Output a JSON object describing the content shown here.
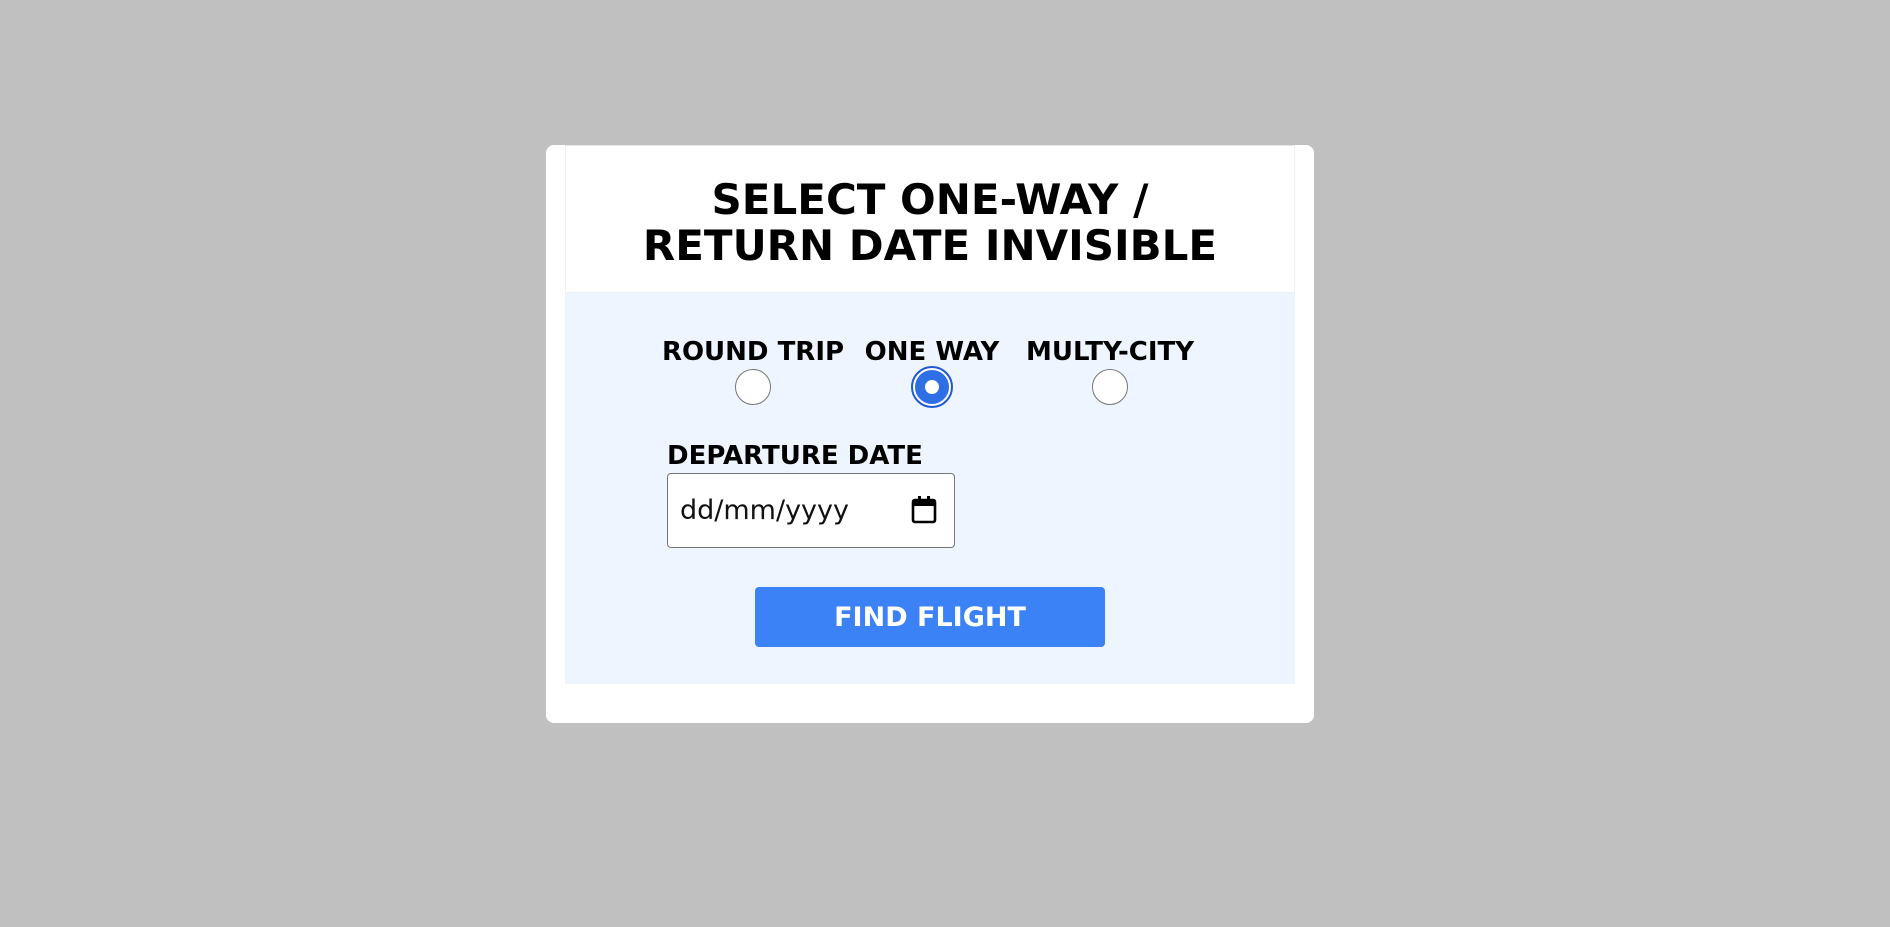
{
  "header": {
    "title_line1": "SELECT ONE-WAY /",
    "title_line2": "RETURN DATE INVISIBLE"
  },
  "trip_type": {
    "options": [
      {
        "label": "ROUND TRIP",
        "checked": false
      },
      {
        "label": "ONE WAY",
        "checked": true
      },
      {
        "label": "MULTY-CITY",
        "checked": false
      }
    ]
  },
  "departure": {
    "label": "DEPARTURE DATE",
    "placeholder": "dd/mm/yyyy",
    "icon": "calendar-icon"
  },
  "actions": {
    "find_label": "FIND FLIGHT"
  },
  "colors": {
    "page_background": "#c0c0c0",
    "card_background": "#ffffff",
    "form_background": "#eef5fe",
    "accent": "#3b82f6",
    "radio_checked": "#2f6fe6"
  }
}
